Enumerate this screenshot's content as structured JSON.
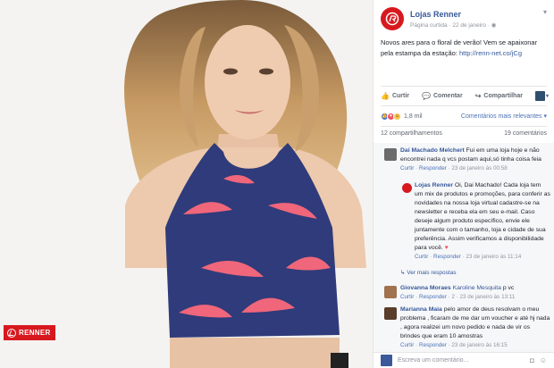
{
  "post": {
    "page_name": "Lojas Renner",
    "meta": "Página curtida · 22 de janeiro · ",
    "text": "Novos ares para o floral de verão! Vem se apaixonar pela estampa da estação: ",
    "link": "http://renn-net.co/jCg",
    "watermark": "RENNER"
  },
  "actions": {
    "like": "Curtir",
    "comment": "Comentar",
    "share": "Compartilhar"
  },
  "reactions": {
    "count": "1,8 mil",
    "filter": "Comentários mais relevantes ▾"
  },
  "stats": {
    "shares": "12 compartilhamentos",
    "comments": "19 comentários"
  },
  "comments": [
    {
      "name": "Dai Machado Melchert",
      "text": " Fui em uma loja hoje e não encontrei nada q vcs postam aqui,só tinha coisa feia",
      "meta_like": "Curtir",
      "meta_reply": "Responder",
      "meta_time": " · 23 de janeiro às 00:58"
    },
    {
      "name": "Lojas Renner",
      "text": " Oi, Dai Machado! Cada loja tem um mix de produtos e promoções, para conferir as novidades na nossa loja virtual cadastre-se na newsletter e receba ela em seu e-mail. Caso deseje algum produto específico, envie ele juntamente com o tamanho, loja e cidade de sua preferência. Assim verificamos a disponibilidade para você. ",
      "meta_like": "Curtir",
      "meta_reply": "Responder",
      "meta_time": " · 23 de janeiro às 11:14"
    },
    {
      "name": "Giovanna Moraes",
      "mention": "Karoline Mesquita",
      "text": " p vc",
      "meta_like": "Curtir",
      "meta_reply": "Responder",
      "meta_time": " · 2 · 23 de janeiro às 13:11"
    },
    {
      "name": "Marianna Maia",
      "text": " pelo amor de deus resolvam o meu problema , ficaram de me dar um voucher e até hj nada , agora realizei um novo pedido e nada de vir os brindes que eram 10 amostras",
      "meta_like": "Curtir",
      "meta_reply": "Responder",
      "meta_time": " · 23 de janeiro às 16:15"
    }
  ],
  "more_replies": "Ver mais respostas",
  "compose": {
    "placeholder": "Escreva um comentário..."
  },
  "icons": {
    "chevron": "chevron-down-icon",
    "like": "thumbs-up-icon",
    "comment": "comment-icon",
    "share": "share-icon"
  },
  "colors": {
    "brand": "#d7191f",
    "link": "#365899"
  }
}
